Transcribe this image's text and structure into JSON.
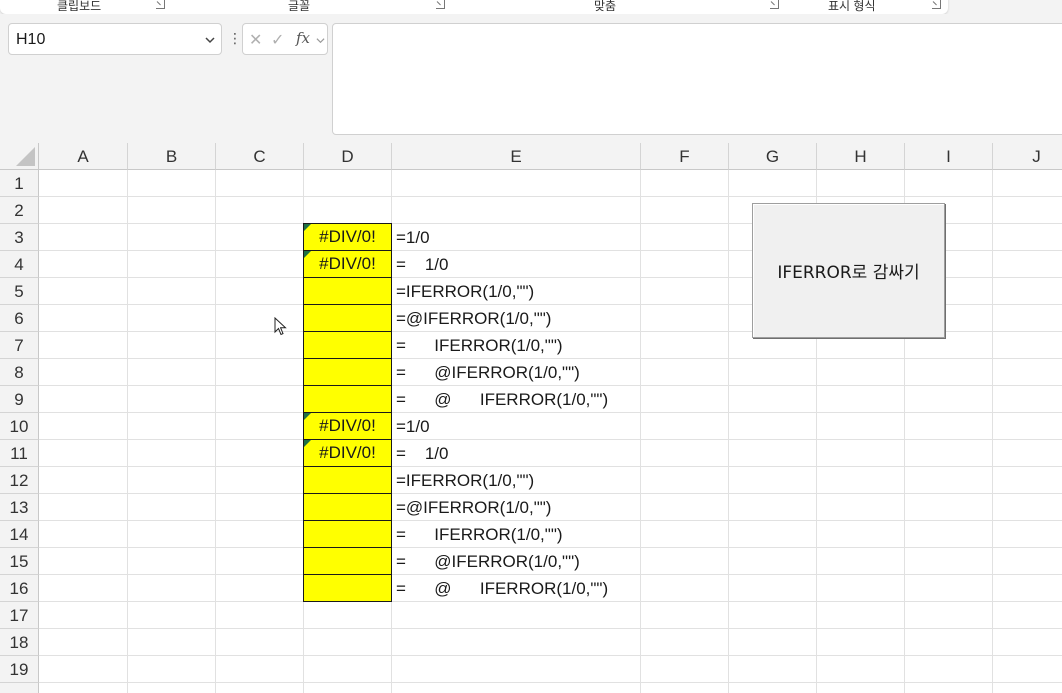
{
  "ribbon": {
    "groups": [
      {
        "label": "클립보드"
      },
      {
        "label": "글꼴"
      },
      {
        "label": "맞춤"
      },
      {
        "label": "표시 형식"
      }
    ]
  },
  "name_box": {
    "value": "H10"
  },
  "formula_bar": {
    "fx_label": "fx",
    "cancel_glyph": "✕",
    "enter_glyph": "✓",
    "value": ""
  },
  "columns": [
    "A",
    "B",
    "C",
    "D",
    "E",
    "F",
    "G",
    "H",
    "I",
    "J"
  ],
  "rows": [
    "1",
    "2",
    "3",
    "4",
    "5",
    "6",
    "7",
    "8",
    "9",
    "10",
    "11",
    "12",
    "13",
    "14",
    "15",
    "16",
    "17",
    "18",
    "19"
  ],
  "cells": {
    "D3": "#DIV/0!",
    "D4": "#DIV/0!",
    "D10": "#DIV/0!",
    "D11": "#DIV/0!",
    "E3": "=1/0",
    "E4": "=    1/0",
    "E5": "=IFERROR(1/0,\"\")",
    "E6": "=@IFERROR(1/0,\"\")",
    "E7": "=      IFERROR(1/0,\"\")",
    "E8": "=      @IFERROR(1/0,\"\")",
    "E9": "=      @      IFERROR(1/0,\"\")",
    "E10": "=1/0",
    "E11": "=    1/0",
    "E12": "=IFERROR(1/0,\"\")",
    "E13": "=@IFERROR(1/0,\"\")",
    "E14": "=      IFERROR(1/0,\"\")",
    "E15": "=      @IFERROR(1/0,\"\")",
    "E16": "=      @      IFERROR(1/0,\"\")"
  },
  "macro_button": {
    "label": "IFERROR로 감싸기"
  }
}
